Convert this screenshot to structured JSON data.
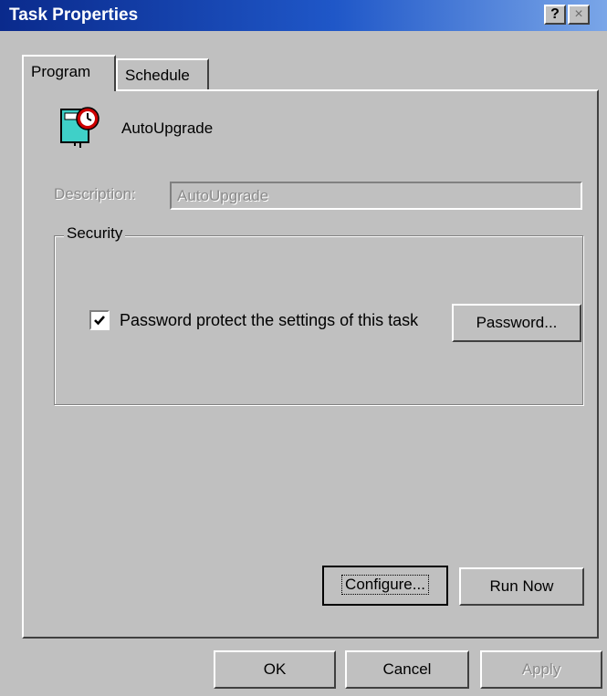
{
  "window": {
    "title": "Task Properties",
    "help_glyph": "?",
    "close_glyph": "×"
  },
  "tabs": [
    {
      "label": "Program",
      "active": true
    },
    {
      "label": "Schedule",
      "active": false
    }
  ],
  "program": {
    "icon": "scheduled-task-clock-icon",
    "name": "AutoUpgrade",
    "description_label": "Description:",
    "description_value": "AutoUpgrade"
  },
  "security": {
    "group_label": "Security",
    "password_protect": {
      "checked": true,
      "label": "Password protect the settings of this task"
    },
    "password_button": "Password..."
  },
  "actions": {
    "configure": "Configure...",
    "run_now": "Run Now"
  },
  "footer": {
    "ok": "OK",
    "cancel": "Cancel",
    "apply": "Apply"
  },
  "colors": {
    "face": "#c0c0c0",
    "title_start": "#0a2a8c",
    "title_end": "#7aa6e8",
    "disabled_text": "#8a8a8a"
  }
}
